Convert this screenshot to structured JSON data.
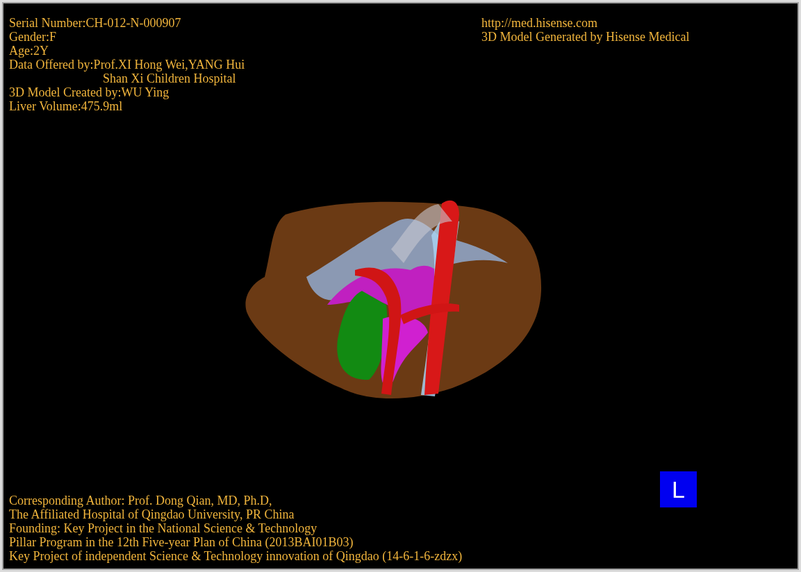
{
  "info_lines": [
    {
      "kind": "line",
      "text": "Serial Number:CH-012-N-000907"
    },
    {
      "kind": "line",
      "text": "Gender:F"
    },
    {
      "kind": "line",
      "text": "Age:2Y"
    },
    {
      "kind": "line",
      "text": "Data Offered by:Prof.XI Hong Wei,YANG Hui"
    },
    {
      "kind": "continuation",
      "text": "Shan Xi Children Hospital"
    },
    {
      "kind": "line",
      "text": "3D Model Created by:WU Ying"
    },
    {
      "kind": "line",
      "text": "Liver Volume:475.9ml"
    }
  ],
  "header_right": {
    "link": "http://med.hisense.com",
    "caption": "3D Model Generated by Hisense Medical"
  },
  "credits": [
    "Corresponding Author: Prof. Dong Qian, MD, Ph.D,",
    "The Affiliated Hospital of Qingdao University, PR China",
    "Founding: Key Project in the National Science & Technology",
    "Pillar Program in the 12th Five-year Plan of China (2013BAI01B03)",
    "Key Project of independent Science & Technology innovation of Qingdao (14-6-1-6-zdzx)"
  ],
  "orientation_marker": "L"
}
